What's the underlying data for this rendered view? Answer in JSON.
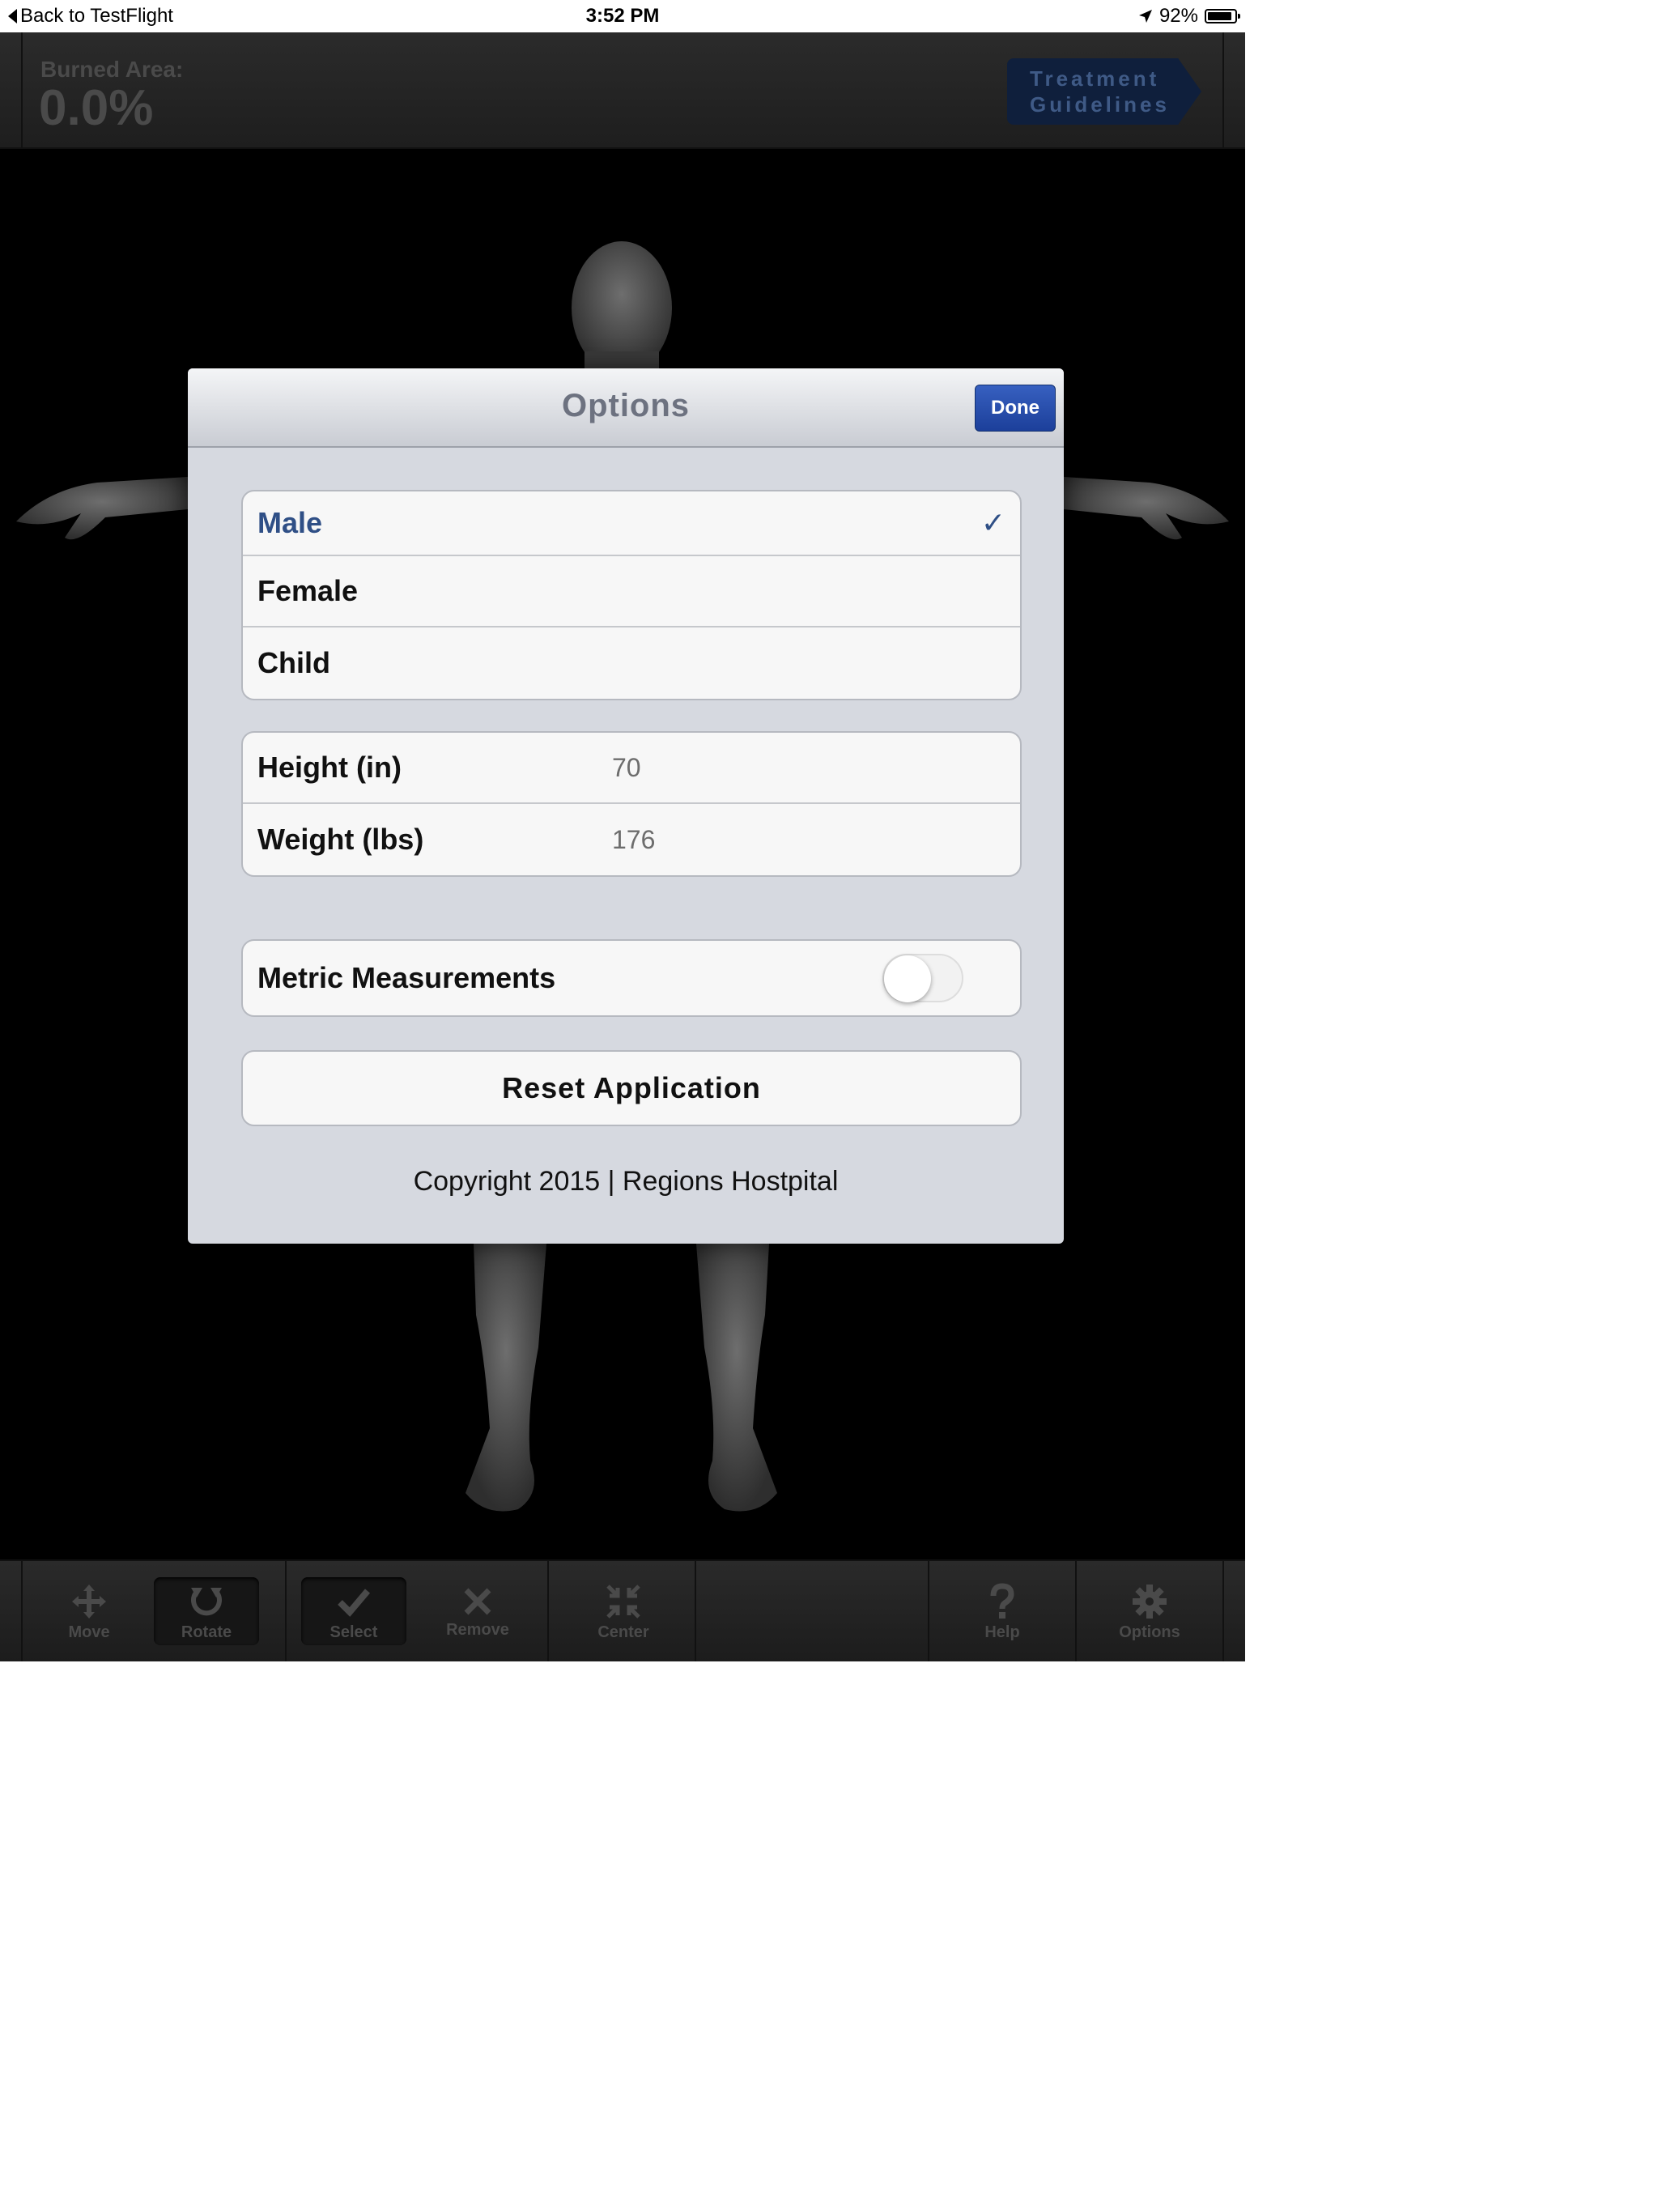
{
  "status_bar": {
    "back_label": "Back to TestFlight",
    "time": "3:52 PM",
    "battery_percent": "92%",
    "battery_level": 0.92
  },
  "top_bar": {
    "burned_area_label": "Burned Area:",
    "burned_area_value": "0.0%",
    "treatment_line1": "Treatment",
    "treatment_line2": "Guidelines"
  },
  "toolbar": {
    "items": [
      {
        "label": "Move",
        "icon": "move-arrows-icon"
      },
      {
        "label": "Rotate",
        "icon": "rotate-icon"
      },
      {
        "label": "Select",
        "icon": "checkmark-icon"
      },
      {
        "label": "Remove",
        "icon": "x-icon"
      },
      {
        "label": "Center",
        "icon": "center-compress-icon"
      },
      {
        "label": "Help",
        "icon": "question-mark-icon"
      },
      {
        "label": "Options",
        "icon": "gear-icon"
      }
    ]
  },
  "modal": {
    "title": "Options",
    "done_label": "Done",
    "body_types": [
      {
        "label": "Male",
        "selected": true
      },
      {
        "label": "Female",
        "selected": false
      },
      {
        "label": "Child",
        "selected": false
      }
    ],
    "check_glyph": "✓",
    "measurements": [
      {
        "label": "Height (in)",
        "value": "70"
      },
      {
        "label": "Weight (lbs)",
        "value": "176"
      }
    ],
    "metric_label": "Metric Measurements",
    "metric_enabled": false,
    "reset_label": "Reset Application",
    "copyright": "Copyright 2015 | Regions Hostpital"
  }
}
